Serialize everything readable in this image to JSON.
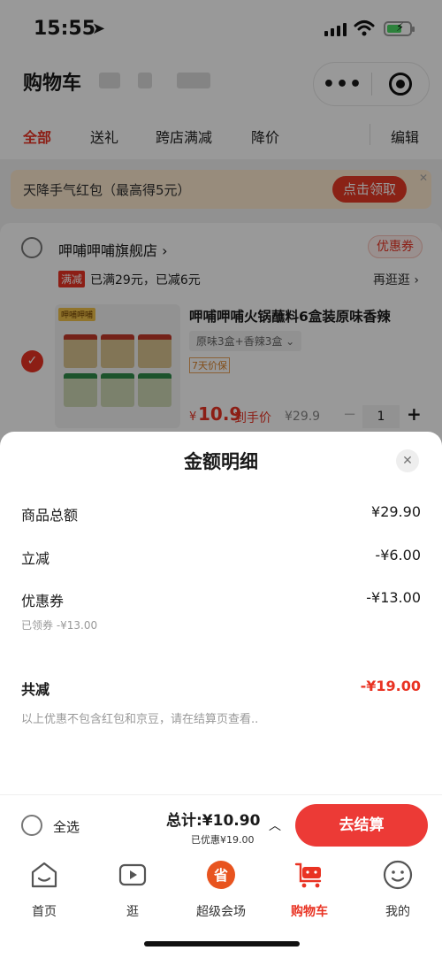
{
  "status_bar": {
    "time": "15:55"
  },
  "header": {
    "title": "购物车"
  },
  "tabs": [
    {
      "label": "全部",
      "active": true
    },
    {
      "label": "送礼"
    },
    {
      "label": "跨店满减"
    },
    {
      "label": "降价"
    },
    {
      "label": "编辑"
    }
  ],
  "banner": {
    "text": "天降手气红包（最高得5元）",
    "button": "点击领取"
  },
  "store": {
    "name": "呷哺呷哺旗舰店 ›",
    "coupon_tag": "优惠券",
    "promo_tag": "满减",
    "promo_text": "已满29元，已减6元",
    "more": "再逛逛 ›"
  },
  "product": {
    "brand": "呷哺呷哺",
    "title": "呷哺呷哺火锅蘸料6盒装原味香辣",
    "spec": "原味3盒+香辣3盒 ⌄",
    "guarantee": "7天价保",
    "price_symbol": "¥",
    "price": "10.9",
    "price_label": "到手价",
    "orig_price": "¥29.9",
    "minus": "−",
    "qty": "1",
    "plus": "+"
  },
  "sheet": {
    "title": "金额明细",
    "rows": [
      {
        "label": "商品总额",
        "value": "¥29.90"
      },
      {
        "label": "立减",
        "value": "-¥6.00"
      },
      {
        "label": "优惠券",
        "value": "-¥13.00"
      }
    ],
    "coupon_sub": "已领券 -¥13.00",
    "total_label": "共减",
    "total_value": "-¥19.00",
    "note": "以上优惠不包含红包和京豆，请在结算页查看.."
  },
  "sumbar": {
    "select_all": "全选",
    "total": "总计:¥10.90",
    "saved": "已优惠¥19.00",
    "checkout": "去结算"
  },
  "tabbar": [
    {
      "label": "首页",
      "icon": "home-icon"
    },
    {
      "label": "逛",
      "icon": "video-icon"
    },
    {
      "label": "超级会场",
      "icon": "venue-icon"
    },
    {
      "label": "购物车",
      "icon": "cart-icon",
      "active": true
    },
    {
      "label": "我的",
      "icon": "profile-icon"
    }
  ],
  "colors": {
    "accent": "#e93323",
    "banner_bg": "#fde9cf"
  }
}
